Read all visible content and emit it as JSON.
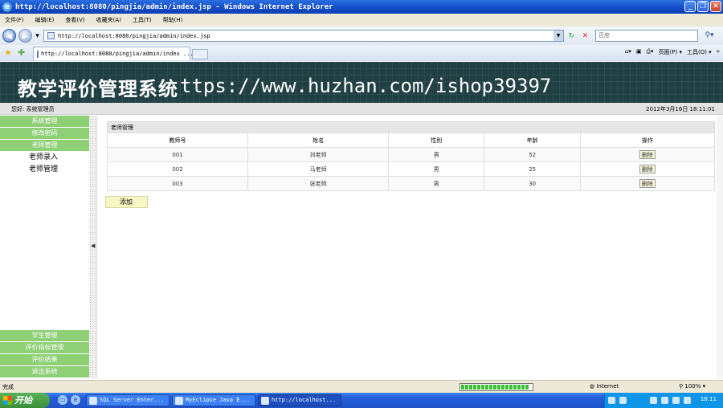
{
  "window": {
    "title": "http://localhost:8080/pingjia/admin/index.jsp - Windows Internet Explorer",
    "min": "_",
    "max": "❐",
    "close": "✕"
  },
  "menubar": [
    "文件(F)",
    "编辑(E)",
    "查看(V)",
    "收藏夹(A)",
    "工具(T)",
    "帮助(H)"
  ],
  "address": {
    "url": "http://localhost:8080/pingjia/admin/index.jsp",
    "search_placeholder": "百度"
  },
  "tab": {
    "label": "http://localhost:8080/pingjia/admin/index ..."
  },
  "commands": [
    "页面(P) ▾",
    "工具(O) ▾"
  ],
  "page": {
    "system_title": "教学评价管理系统",
    "watermark": "ttps://www.huzhan.com/ishop39397",
    "welcome": "您好: 系统管理员",
    "datetime": "2012年3月16日  18:11:01"
  },
  "sidebar": {
    "top": [
      "系统管理",
      "修改密码",
      "老师管理"
    ],
    "sub": [
      "老师录入",
      "老师管理"
    ],
    "bottom": [
      "学生管理",
      "评价指标管理",
      "评价结果",
      "退出系统"
    ]
  },
  "panel": {
    "title": "老师管理",
    "columns": [
      "教师号",
      "姓名",
      "性别",
      "年龄",
      "操作"
    ],
    "rows": [
      [
        "001",
        "刘老师",
        "男",
        "52"
      ],
      [
        "002",
        "马老师",
        "男",
        "25"
      ],
      [
        "003",
        "张老师",
        "男",
        "30"
      ]
    ],
    "delete_label": "删除",
    "add_label": "添加"
  },
  "statusbar": {
    "status": "完成",
    "zone": "Internet",
    "zoom": "100%",
    "progress": 1.0
  },
  "taskbar": {
    "start": "开始",
    "tasks": [
      "SQL Server Enter...",
      "MyEclipse Java E...",
      "http://localhost..."
    ],
    "clock": "18:11"
  }
}
